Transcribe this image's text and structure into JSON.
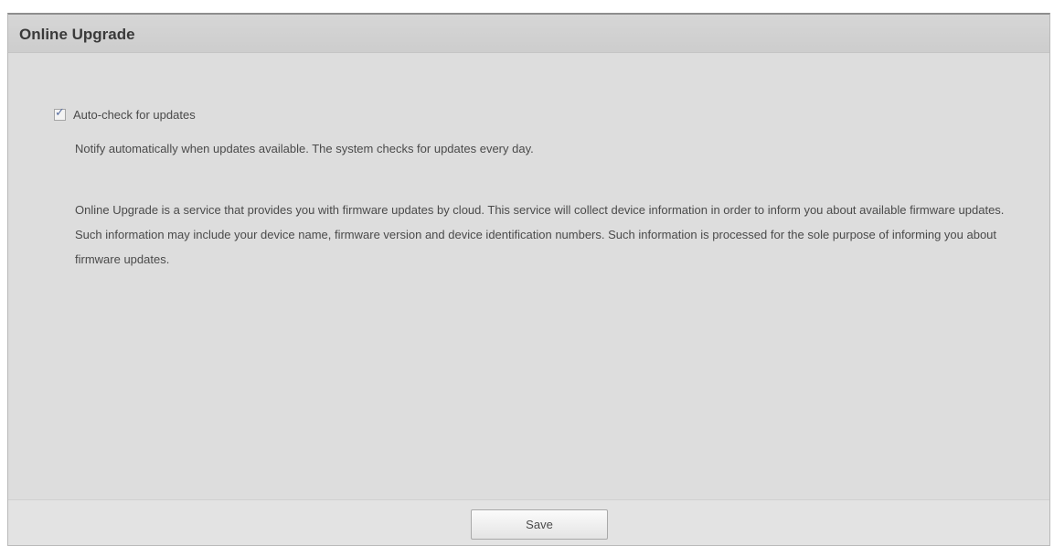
{
  "panel": {
    "title": "Online Upgrade"
  },
  "auto_check": {
    "checked": true,
    "label": "Auto-check for updates"
  },
  "notify_text": "Notify automatically when updates available. The system checks for updates every day.",
  "description": "Online Upgrade is a service that provides you with firmware updates by cloud. This service will collect device information in order to inform you about available firmware updates. Such information may include your device name, firmware version and device identification numbers. Such information is processed for the sole purpose of informing you about firmware updates.",
  "footer": {
    "save_label": "Save"
  },
  "colors": {
    "panel_background": "#dddddd",
    "title_bar": "#d2d2d2",
    "text": "#4a4a4a",
    "checkmark": "#5a6fa0"
  },
  "icons": {
    "checkbox": "checkmark-icon"
  }
}
